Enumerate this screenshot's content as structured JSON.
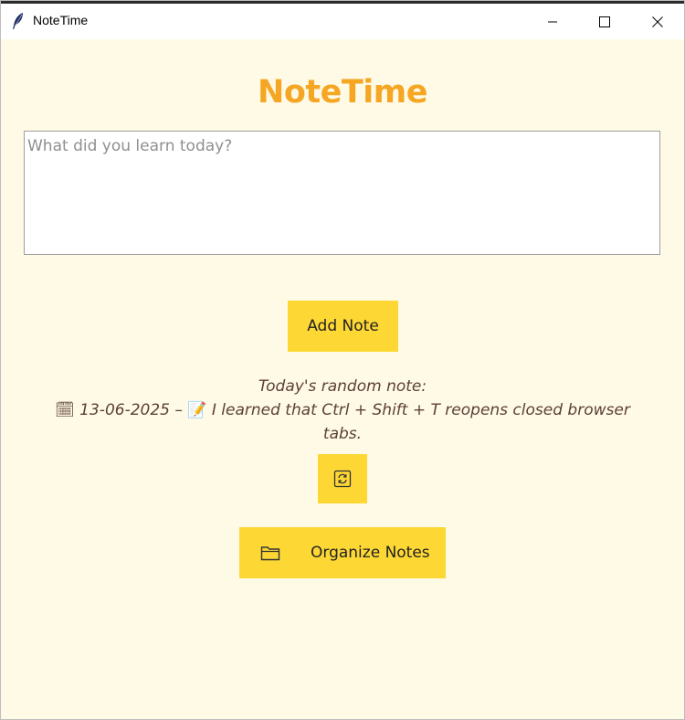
{
  "window": {
    "title": "NoteTime",
    "icons": {
      "app": "feather-icon",
      "minimize": "minimize-icon",
      "maximize": "maximize-icon",
      "close": "close-icon"
    }
  },
  "app": {
    "heading": "NoteTime",
    "note_input": {
      "placeholder": "What did you learn today?",
      "value": ""
    },
    "add_button_label": "Add Note",
    "random_note": {
      "header": "Today's random note:",
      "date_glyph": "🗓",
      "date": "13-06-2025",
      "separator": "–",
      "note_glyph": "📝",
      "text": "I learned that Ctrl + Shift + T reopens closed browser tabs."
    },
    "refresh_button_icon": "refresh-icon",
    "organize_button": {
      "icon": "folder-icon",
      "label": "Organize Notes"
    }
  },
  "colors": {
    "background": "#fffae6",
    "heading": "#f5a623",
    "button": "#fdd835",
    "note_text": "#5d4037"
  }
}
